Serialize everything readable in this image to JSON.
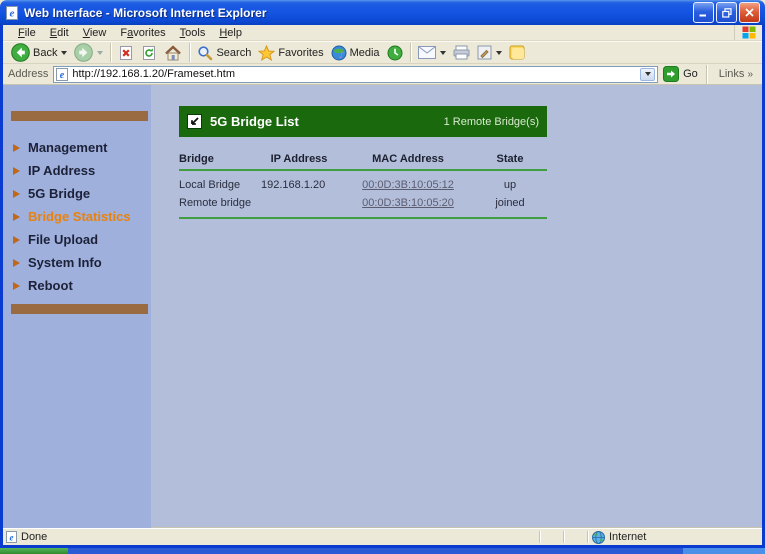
{
  "window": {
    "title": "Web Interface - Microsoft Internet Explorer"
  },
  "menu": {
    "items": [
      {
        "label": "File",
        "accel": 0
      },
      {
        "label": "Edit",
        "accel": 0
      },
      {
        "label": "View",
        "accel": 0
      },
      {
        "label": "Favorites",
        "accel": 1
      },
      {
        "label": "Tools",
        "accel": 0
      },
      {
        "label": "Help",
        "accel": 0
      }
    ]
  },
  "toolbar": {
    "buttons": [
      {
        "icon": "back-circle-arrow-icon",
        "label": "Back"
      },
      {
        "icon": "forward-circle-arrow-icon",
        "label": ""
      },
      {
        "icon": "stop-icon",
        "label": ""
      },
      {
        "icon": "refresh-icon",
        "label": ""
      },
      {
        "icon": "home-icon",
        "label": ""
      },
      {
        "icon": "search-icon",
        "label": "Search"
      },
      {
        "icon": "favorites-star-icon",
        "label": "Favorites"
      },
      {
        "icon": "media-icon",
        "label": "Media"
      },
      {
        "icon": "history-icon",
        "label": ""
      },
      {
        "icon": "mail-icon",
        "label": ""
      },
      {
        "icon": "print-icon",
        "label": ""
      },
      {
        "icon": "edit-icon",
        "label": ""
      },
      {
        "icon": "messenger-icon",
        "label": ""
      }
    ]
  },
  "address": {
    "label": "Address",
    "url": "http://192.168.1.20/Frameset.htm",
    "go": "Go",
    "links": "Links",
    "links_chevron": "»"
  },
  "sidebar": {
    "items": [
      {
        "label": "Management",
        "active": false
      },
      {
        "label": "IP Address",
        "active": false
      },
      {
        "label": "5G Bridge",
        "active": false
      },
      {
        "label": "Bridge Statistics",
        "active": true
      },
      {
        "label": "File Upload",
        "active": false
      },
      {
        "label": "System Info",
        "active": false
      },
      {
        "label": "Reboot",
        "active": false
      }
    ]
  },
  "content": {
    "panel_title": "5G Bridge List",
    "panel_right": "1 Remote Bridge(s)",
    "table": {
      "columns": [
        "Bridge",
        "IP Address",
        "MAC Address",
        "State"
      ],
      "rows": [
        {
          "bridge": "Local Bridge",
          "ip": "192.168.1.20",
          "mac": "00:0D:3B:10:05:12",
          "state": "up"
        },
        {
          "bridge": "Remote bridge",
          "ip": "",
          "mac": "00:0D:3B:10:05:20",
          "state": "joined"
        }
      ]
    }
  },
  "status": {
    "text": "Done",
    "zone": "Internet"
  },
  "colors": {
    "titlebar_blue": "#1353e0",
    "window_border": "#0a3bd0",
    "chrome_tan": "#ece9d8",
    "sidebar_blue": "#9fb0dd",
    "content_blue": "#b3bfda",
    "panel_green": "#1a690d",
    "table_line_green": "#3f9e3f",
    "accent_brown": "#9a6a40",
    "active_orange": "#e8820e",
    "link_gray": "#5c5c70"
  }
}
